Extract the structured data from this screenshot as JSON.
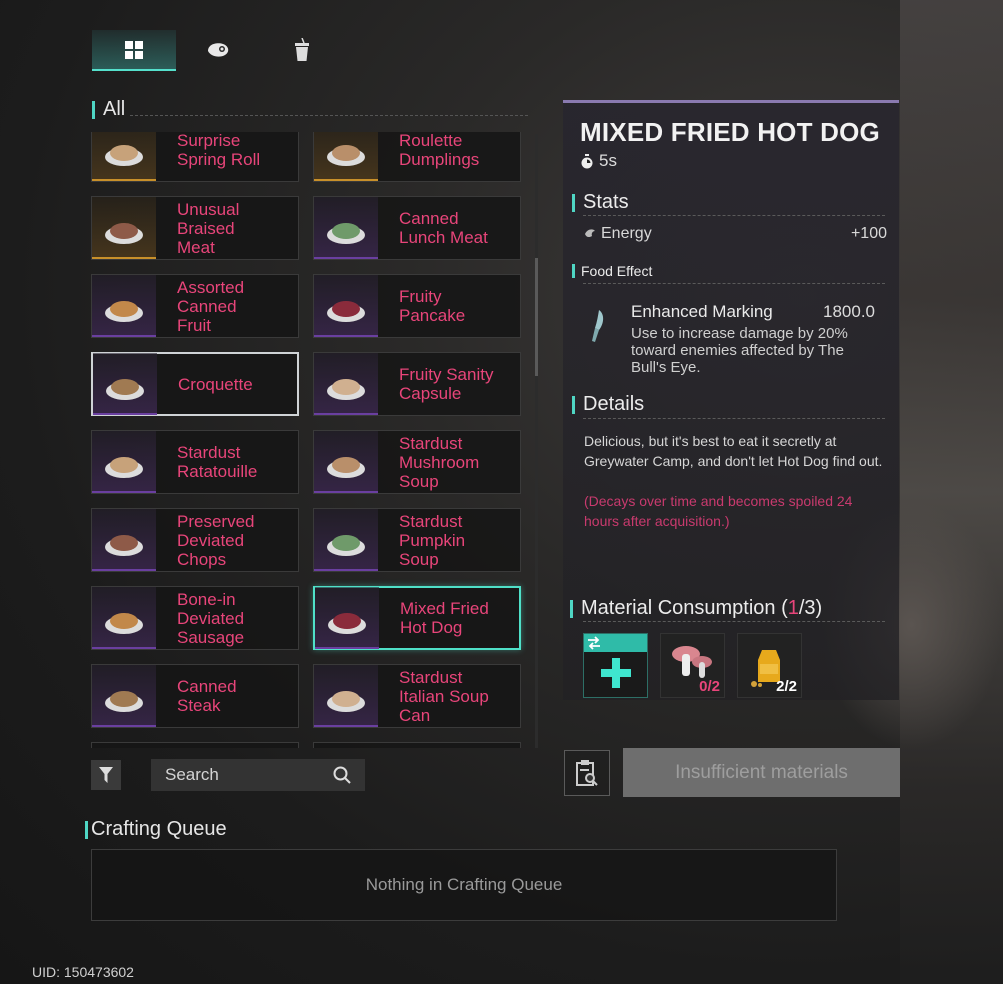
{
  "tabs": [
    {
      "icon": "grid-icon",
      "active": true
    },
    {
      "icon": "meat-icon",
      "active": false
    },
    {
      "icon": "drink-icon",
      "active": false
    }
  ],
  "list": {
    "section_label": "All",
    "items": [
      {
        "name": "Surprise Spring Roll",
        "lines": [
          "Surprise",
          "Spring Roll"
        ],
        "rarity": "gold"
      },
      {
        "name": "Roulette Dumplings",
        "lines": [
          "Roulette",
          "Dumplings"
        ],
        "rarity": "gold"
      },
      {
        "name": "Unusual Braised Meat",
        "lines": [
          "Unusual",
          "Braised",
          "Meat"
        ],
        "rarity": "gold"
      },
      {
        "name": "Canned Lunch Meat",
        "lines": [
          "Canned",
          "Lunch Meat"
        ],
        "rarity": "purple"
      },
      {
        "name": "Assorted Canned Fruit",
        "lines": [
          "Assorted",
          "Canned",
          "Fruit"
        ],
        "rarity": "purple"
      },
      {
        "name": "Fruity Pancake",
        "lines": [
          "Fruity",
          "Pancake"
        ],
        "rarity": "purple"
      },
      {
        "name": "Croquette",
        "lines": [
          "Croquette"
        ],
        "rarity": "purple",
        "selected": "white"
      },
      {
        "name": "Fruity Sanity Capsule",
        "lines": [
          "Fruity Sanity",
          "Capsule"
        ],
        "rarity": "purple"
      },
      {
        "name": "Stardust Ratatouille",
        "lines": [
          "Stardust",
          "Ratatouille"
        ],
        "rarity": "purple"
      },
      {
        "name": "Stardust Mushroom Soup",
        "lines": [
          "Stardust",
          "Mushroom",
          "Soup"
        ],
        "rarity": "purple"
      },
      {
        "name": "Preserved Deviated Chops",
        "lines": [
          "Preserved",
          "Deviated",
          "Chops"
        ],
        "rarity": "purple"
      },
      {
        "name": "Stardust Pumpkin Soup",
        "lines": [
          "Stardust",
          "Pumpkin",
          "Soup"
        ],
        "rarity": "purple"
      },
      {
        "name": "Bone-in Deviated Sausage",
        "lines": [
          "Bone-in",
          "Deviated",
          "Sausage"
        ],
        "rarity": "purple"
      },
      {
        "name": "Mixed Fried Hot Dog",
        "lines": [
          "Mixed Fried",
          "Hot Dog"
        ],
        "rarity": "purple",
        "selected": "teal"
      },
      {
        "name": "Canned Steak",
        "lines": [
          "Canned",
          "Steak"
        ],
        "rarity": "purple"
      },
      {
        "name": "Stardust Italian Soup Can",
        "lines": [
          "Stardust",
          "Italian Soup",
          "Can"
        ],
        "rarity": "purple"
      }
    ]
  },
  "search": {
    "placeholder": "Search"
  },
  "queue": {
    "label": "Crafting Queue",
    "empty_text": "Nothing in Crafting Queue"
  },
  "uid": "UID: 150473602",
  "detail": {
    "title": "MIXED FRIED HOT DOG",
    "time": "5s",
    "stats_label": "Stats",
    "stat_name": "Energy",
    "stat_value": "+100",
    "food_effect_label": "Food Effect",
    "effect_name": "Enhanced Marking",
    "effect_value": "1800.0",
    "effect_desc": "Use to increase damage by 20% toward enemies affected by The Bull's Eye.",
    "details_label": "Details",
    "details_text": "Delicious, but it's best to eat it secretly at Greywater Camp, and don't let Hot Dog find out.",
    "details_warning": "(Decays over time and becomes spoiled 24 hours after acquisition.)",
    "material_label_prefix": "Material Consumption (",
    "material_have": "1",
    "material_label_suffix": "/3)",
    "materials": [
      {
        "icon": "add-material-icon",
        "count": ""
      },
      {
        "icon": "mushroom-icon",
        "count": "0/2",
        "count_color": "#e8457a"
      },
      {
        "icon": "oil-bottle-icon",
        "count": "2/2",
        "count_color": "#ffffff"
      }
    ],
    "craft_button": "Insufficient materials"
  },
  "colors": {
    "accent": "#4fd6c4",
    "item_name": "#e8457a",
    "warning": "#c93a6e"
  }
}
